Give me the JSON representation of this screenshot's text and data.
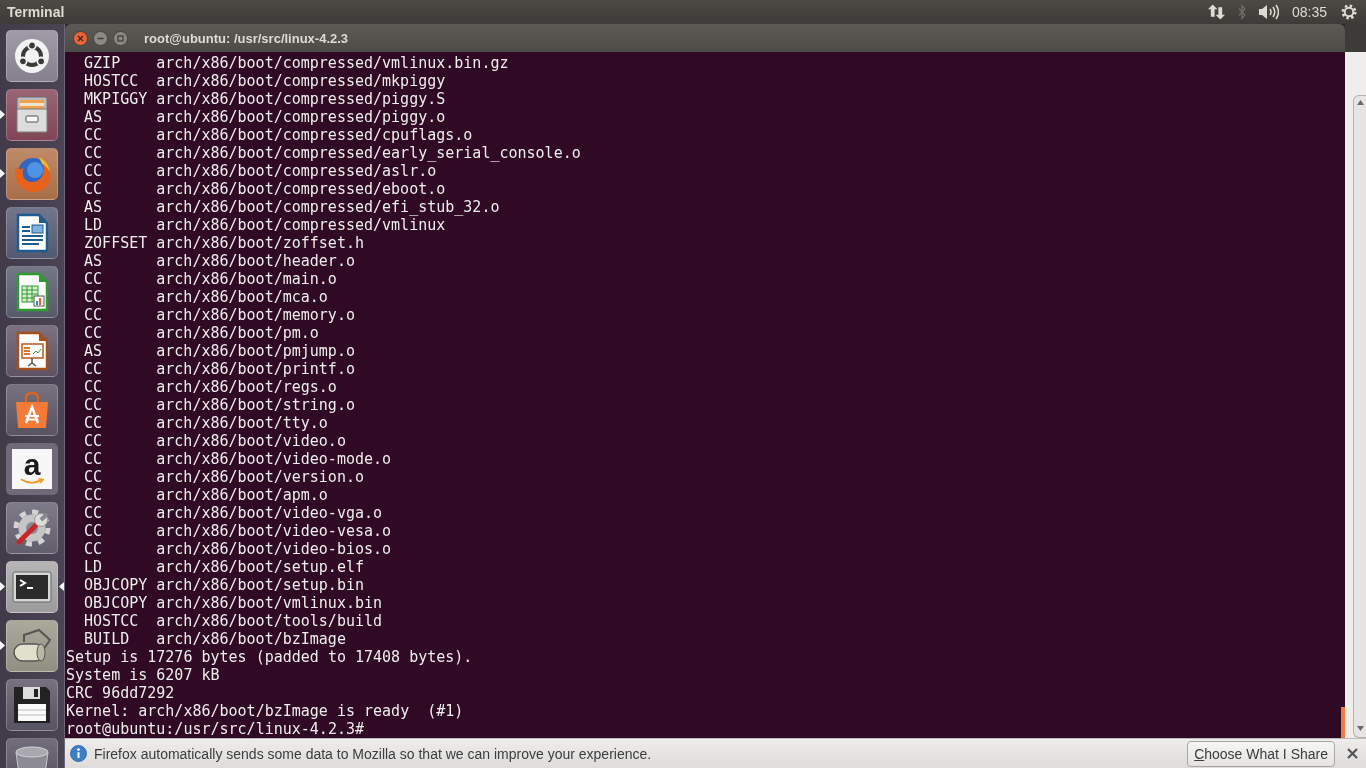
{
  "top_panel": {
    "title": "Terminal",
    "indicators": [
      {
        "kind": "network",
        "disabled": false
      },
      {
        "kind": "bluetooth",
        "disabled": true
      },
      {
        "kind": "volume",
        "disabled": false
      }
    ],
    "clock": "08:35"
  },
  "launcher": [
    {
      "kind": "dash",
      "running": false,
      "focused": false
    },
    {
      "kind": "files",
      "running": true,
      "focused": false
    },
    {
      "kind": "browser",
      "running": true,
      "focused": false
    },
    {
      "kind": "document",
      "running": false,
      "focused": false
    },
    {
      "kind": "spreadsheet",
      "running": false,
      "focused": false
    },
    {
      "kind": "presentation",
      "running": false,
      "focused": false
    },
    {
      "kind": "store",
      "running": false,
      "focused": false
    },
    {
      "kind": "letter",
      "label": "a",
      "running": false,
      "focused": false
    },
    {
      "kind": "settings",
      "running": false,
      "focused": false
    },
    {
      "kind": "terminal",
      "running": true,
      "focused": true
    },
    {
      "kind": "roller",
      "running": true,
      "focused": false
    },
    {
      "kind": "floppy",
      "running": false,
      "focused": false
    },
    {
      "kind": "trash",
      "running": false,
      "focused": false
    }
  ],
  "terminal": {
    "title": "root@ubuntu: /usr/src/linux-4.2.3",
    "lines": [
      {
        "kind": "build",
        "tool": "GZIP",
        "file": "arch/x86/boot/compressed/vmlinux.bin.gz"
      },
      {
        "kind": "build",
        "tool": "HOSTCC",
        "file": "arch/x86/boot/compressed/mkpiggy"
      },
      {
        "kind": "build",
        "tool": "MKPIGGY",
        "file": "arch/x86/boot/compressed/piggy.S"
      },
      {
        "kind": "build",
        "tool": "AS",
        "file": "arch/x86/boot/compressed/piggy.o"
      },
      {
        "kind": "build",
        "tool": "CC",
        "file": "arch/x86/boot/compressed/cpuflags.o"
      },
      {
        "kind": "build",
        "tool": "CC",
        "file": "arch/x86/boot/compressed/early_serial_console.o"
      },
      {
        "kind": "build",
        "tool": "CC",
        "file": "arch/x86/boot/compressed/aslr.o"
      },
      {
        "kind": "build",
        "tool": "CC",
        "file": "arch/x86/boot/compressed/eboot.o"
      },
      {
        "kind": "build",
        "tool": "AS",
        "file": "arch/x86/boot/compressed/efi_stub_32.o"
      },
      {
        "kind": "build",
        "tool": "LD",
        "file": "arch/x86/boot/compressed/vmlinux"
      },
      {
        "kind": "build",
        "tool": "ZOFFSET",
        "file": "arch/x86/boot/zoffset.h"
      },
      {
        "kind": "build",
        "tool": "AS",
        "file": "arch/x86/boot/header.o"
      },
      {
        "kind": "build",
        "tool": "CC",
        "file": "arch/x86/boot/main.o"
      },
      {
        "kind": "build",
        "tool": "CC",
        "file": "arch/x86/boot/mca.o"
      },
      {
        "kind": "build",
        "tool": "CC",
        "file": "arch/x86/boot/memory.o"
      },
      {
        "kind": "build",
        "tool": "CC",
        "file": "arch/x86/boot/pm.o"
      },
      {
        "kind": "build",
        "tool": "AS",
        "file": "arch/x86/boot/pmjump.o"
      },
      {
        "kind": "build",
        "tool": "CC",
        "file": "arch/x86/boot/printf.o"
      },
      {
        "kind": "build",
        "tool": "CC",
        "file": "arch/x86/boot/regs.o"
      },
      {
        "kind": "build",
        "tool": "CC",
        "file": "arch/x86/boot/string.o"
      },
      {
        "kind": "build",
        "tool": "CC",
        "file": "arch/x86/boot/tty.o"
      },
      {
        "kind": "build",
        "tool": "CC",
        "file": "arch/x86/boot/video.o"
      },
      {
        "kind": "build",
        "tool": "CC",
        "file": "arch/x86/boot/video-mode.o"
      },
      {
        "kind": "build",
        "tool": "CC",
        "file": "arch/x86/boot/version.o"
      },
      {
        "kind": "build",
        "tool": "CC",
        "file": "arch/x86/boot/apm.o"
      },
      {
        "kind": "build",
        "tool": "CC",
        "file": "arch/x86/boot/video-vga.o"
      },
      {
        "kind": "build",
        "tool": "CC",
        "file": "arch/x86/boot/video-vesa.o"
      },
      {
        "kind": "build",
        "tool": "CC",
        "file": "arch/x86/boot/video-bios.o"
      },
      {
        "kind": "build",
        "tool": "LD",
        "file": "arch/x86/boot/setup.elf"
      },
      {
        "kind": "build",
        "tool": "OBJCOPY",
        "file": "arch/x86/boot/setup.bin"
      },
      {
        "kind": "build",
        "tool": "OBJCOPY",
        "file": "arch/x86/boot/vmlinux.bin"
      },
      {
        "kind": "build",
        "tool": "HOSTCC",
        "file": "arch/x86/boot/tools/build"
      },
      {
        "kind": "build",
        "tool": "BUILD",
        "file": "arch/x86/boot/bzImage"
      },
      {
        "kind": "text",
        "text": "Setup is 17276 bytes (padded to 17408 bytes)."
      },
      {
        "kind": "text",
        "text": "System is 6207 kB"
      },
      {
        "kind": "text",
        "text": "CRC 96dd7292"
      },
      {
        "kind": "text",
        "text": "Kernel: arch/x86/boot/bzImage is ready  (#1)"
      },
      {
        "kind": "prompt",
        "text": "root@ubuntu:/usr/src/linux-4.2.3#"
      }
    ]
  },
  "notification": {
    "message": "Firefox automatically sends some data to Mozilla so that we can improve your experience.",
    "button": "Choose What I Share"
  }
}
